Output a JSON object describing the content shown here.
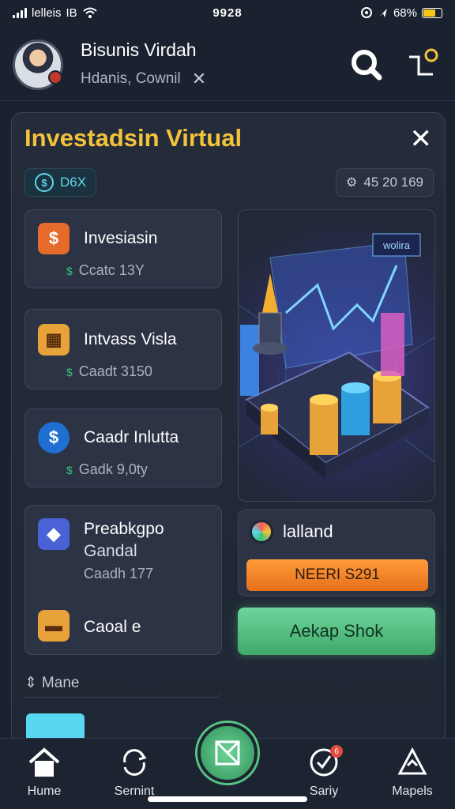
{
  "status_bar": {
    "carrier": "lelleis",
    "network": "IB",
    "time": "9928",
    "battery": "68%",
    "battery_level": 0.68
  },
  "header": {
    "user_name": "Bisunis Virdah",
    "user_subtitle": "Hdanis, Cownil",
    "icons": [
      "search-icon",
      "notification-bell-icon"
    ]
  },
  "panel": {
    "title": "Investadsin Virtual",
    "balance_chip": "D6X",
    "stats_chip": "45 20 169"
  },
  "cards": [
    {
      "title": "Invesiasin",
      "subtitle": "Ccatc 13Y",
      "icon": "shield-icon"
    },
    {
      "title": "Intvass Visla",
      "subtitle": "Caadt 3150",
      "icon": "box-icon"
    },
    {
      "title": "Caadr Inlutta",
      "subtitle": "Gadk 9,0ty",
      "icon": "coin-gear-icon"
    },
    {
      "title": "Preabkgpo",
      "title_line2": "Gandal",
      "subtitle": "Caadh 177",
      "icon": "layers-icon"
    },
    {
      "title": "Caoal e",
      "icon": "gold-bar-icon"
    }
  ],
  "hero": {
    "tag": "wolira"
  },
  "holland": {
    "label": "lalland",
    "button": "NEERI S291"
  },
  "green_button": "Aekap Shok",
  "more_row": "Mane",
  "tabs": [
    {
      "label": "Hume",
      "icon": "home-icon"
    },
    {
      "label": "Sernint",
      "icon": "refresh-icon"
    },
    {
      "label": "Sariy",
      "icon": "check-icon",
      "badge": "6"
    },
    {
      "label": "Mapels",
      "icon": "recycle-icon"
    }
  ],
  "colors": {
    "accent_gold": "#f3c33a",
    "cyan": "#5fd6ea",
    "green": "#39c17a",
    "orange": "#e5701b"
  }
}
